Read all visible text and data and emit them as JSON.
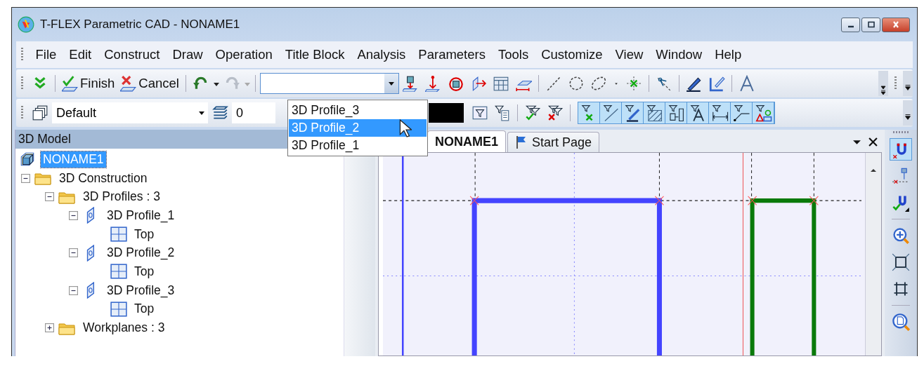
{
  "window": {
    "title": "T-FLEX Parametric CAD - NONAME1"
  },
  "menu": [
    "File",
    "Edit",
    "Construct",
    "Draw",
    "Operation",
    "Title Block",
    "Analysis",
    "Parameters",
    "Tools",
    "Customize",
    "View",
    "Window",
    "Help"
  ],
  "toolbar": {
    "finish": "Finish",
    "cancel": "Cancel",
    "redo_disabled": true,
    "dropdown": {
      "options": [
        {
          "label": "3D Profile_3",
          "selected": false
        },
        {
          "label": "3D Profile_2",
          "selected": true
        },
        {
          "label": "3D Profile_1",
          "selected": false
        }
      ]
    }
  },
  "properties_bar": {
    "style": "Default",
    "layer": "0"
  },
  "model_panel": {
    "title": "3D Model",
    "tree": [
      {
        "label": "NONAME1",
        "kind": "model",
        "selected": true,
        "children": [
          {
            "label": "3D Construction",
            "kind": "folder",
            "selected": false,
            "expanded": true,
            "children": [
              {
                "label": "3D Profiles : 3",
                "kind": "folder",
                "selected": false,
                "expanded": true,
                "children": [
                  {
                    "label": "3D Profile_1",
                    "kind": "profile",
                    "selected": false,
                    "expanded": true,
                    "children": [
                      {
                        "label": "Top",
                        "kind": "plane",
                        "selected": false
                      }
                    ]
                  },
                  {
                    "label": "3D Profile_2",
                    "kind": "profile",
                    "selected": false,
                    "expanded": true,
                    "children": [
                      {
                        "label": "Top",
                        "kind": "plane",
                        "selected": false
                      }
                    ]
                  },
                  {
                    "label": "3D Profile_3",
                    "kind": "profile",
                    "selected": false,
                    "expanded": true,
                    "children": [
                      {
                        "label": "Top",
                        "kind": "plane",
                        "selected": false
                      }
                    ]
                  }
                ]
              },
              {
                "label": "Workplanes : 3",
                "kind": "folder",
                "selected": false,
                "expanded": false
              }
            ]
          }
        ]
      }
    ]
  },
  "tabs": [
    {
      "label": "NONAME1",
      "kind": "document",
      "selected": true
    },
    {
      "label": "Start Page",
      "kind": "start",
      "selected": false
    }
  ]
}
